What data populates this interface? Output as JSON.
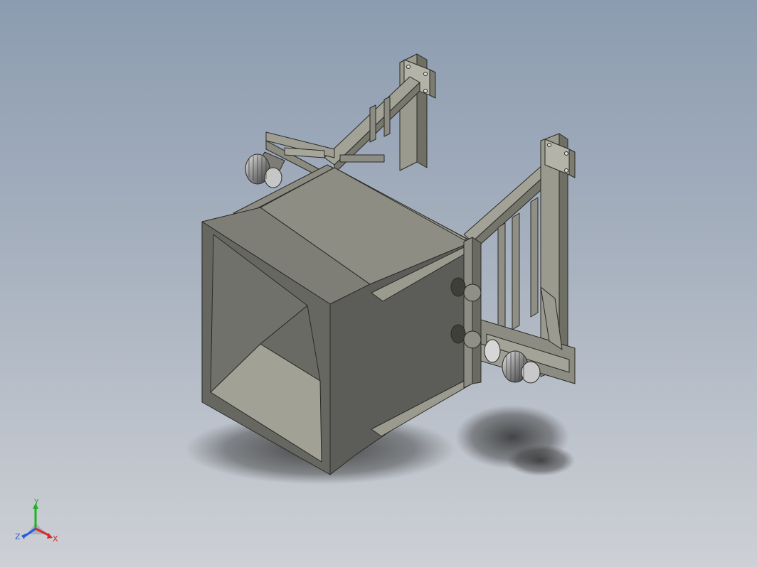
{
  "viewport": {
    "background_top": "#8c9cb0",
    "background_bottom": "#cdd0d5"
  },
  "model": {
    "shading": "shaded-with-edges",
    "shadows": true,
    "base_color": "#8a8a80",
    "edge_color": "#2a2a26"
  },
  "triad": {
    "y_label": "Y",
    "z_label": "Z",
    "x_label": "X",
    "y_color": "#1fb31f",
    "z_color": "#2a5bd7",
    "x_color": "#d62a2a"
  }
}
